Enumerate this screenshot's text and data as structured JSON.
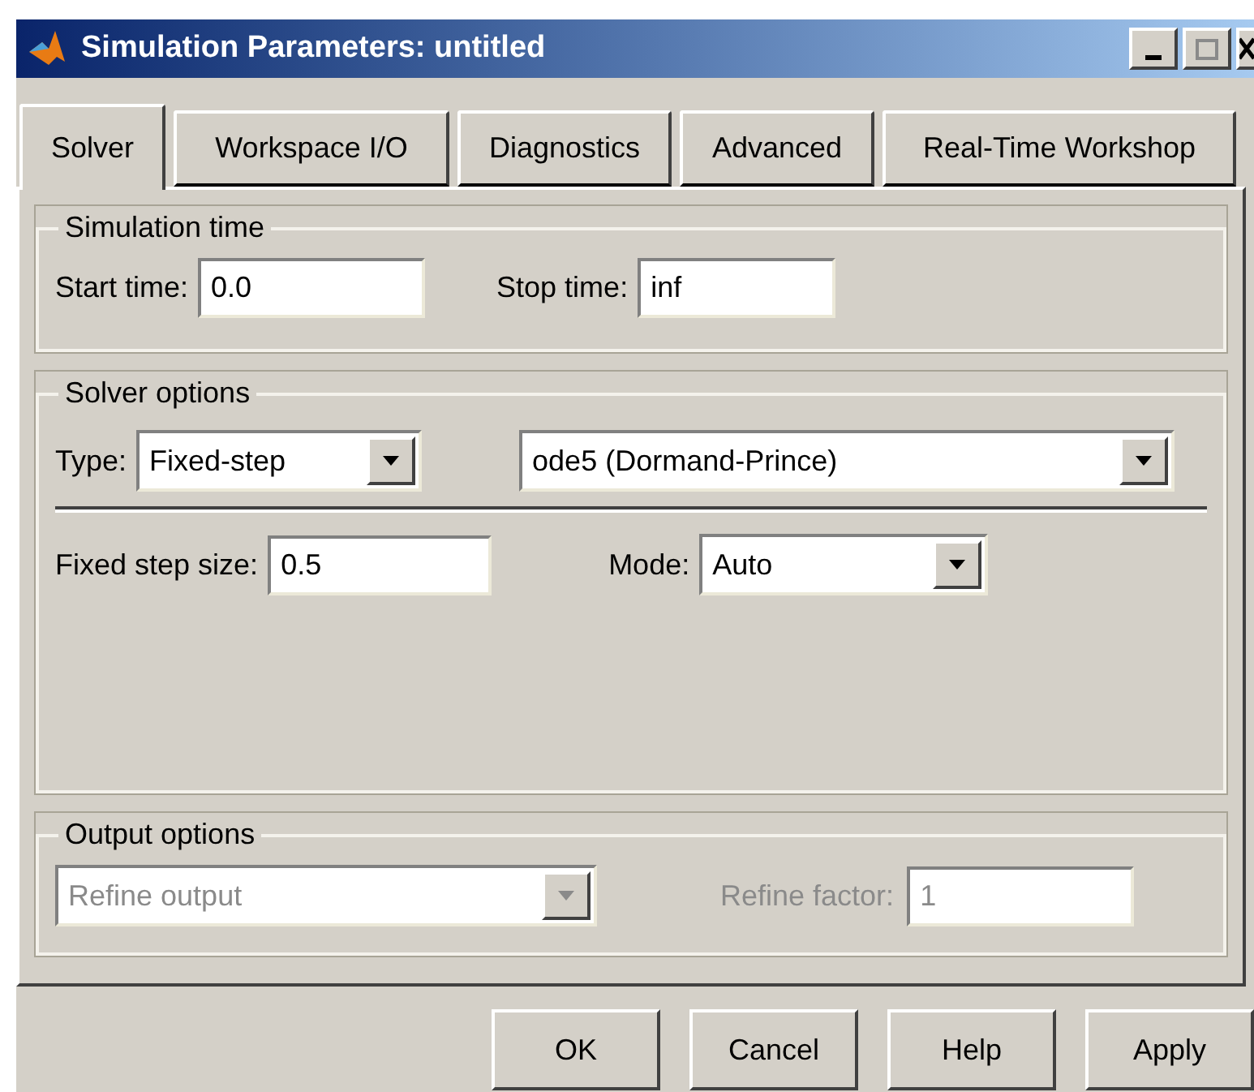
{
  "window": {
    "title": "Simulation Parameters: untitled"
  },
  "tabs": [
    {
      "label": "Solver",
      "selected": true
    },
    {
      "label": "Workspace I/O",
      "selected": false
    },
    {
      "label": "Diagnostics",
      "selected": false
    },
    {
      "label": "Advanced",
      "selected": false
    },
    {
      "label": "Real-Time Workshop",
      "selected": false
    }
  ],
  "simulation_time": {
    "title": "Simulation time",
    "start_time": {
      "label": "Start time:",
      "value": "0.0"
    },
    "stop_time": {
      "label": "Stop time:",
      "value": "inf"
    }
  },
  "solver_options": {
    "title": "Solver options",
    "type": {
      "label": "Type:",
      "value": "Fixed-step"
    },
    "solver": {
      "value": "ode5 (Dormand-Prince)"
    },
    "fixed_step_size": {
      "label": "Fixed step size:",
      "value": "0.5"
    },
    "mode": {
      "label": "Mode:",
      "value": "Auto"
    }
  },
  "output_options": {
    "title": "Output options",
    "refine_output": {
      "value": "Refine output",
      "disabled": true
    },
    "refine_factor": {
      "label": "Refine factor:",
      "value": "1",
      "disabled": true
    }
  },
  "buttons": [
    "OK",
    "Cancel",
    "Help",
    "Apply"
  ]
}
